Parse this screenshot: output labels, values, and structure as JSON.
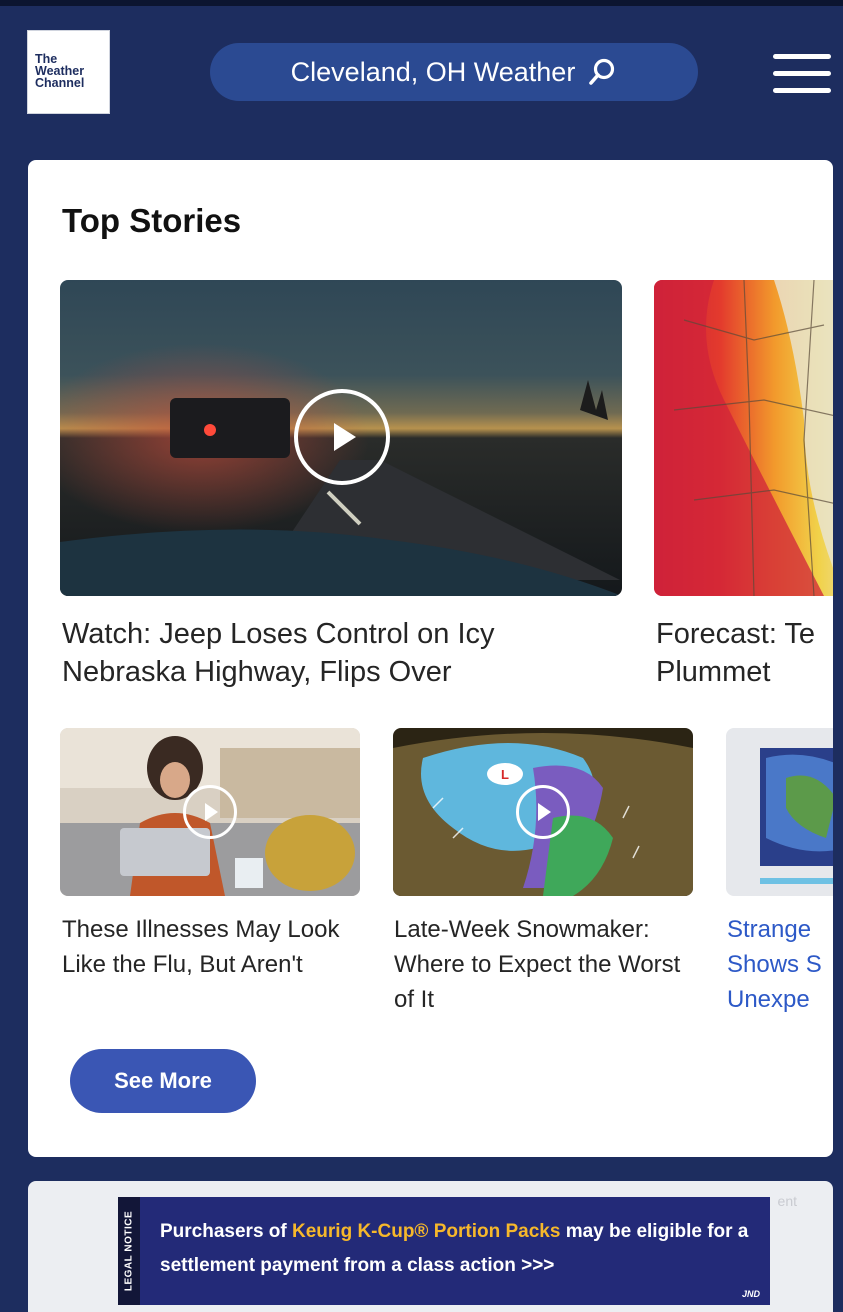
{
  "header": {
    "logo_lines": [
      "The",
      "Weather",
      "Channel"
    ],
    "search_text": "Cleveland, OH Weather"
  },
  "top_stories": {
    "title": "Top Stories",
    "featured": [
      {
        "headline": "Watch: Jeep Loses Control on Icy Nebraska Highway, Flips Over",
        "has_video": true
      },
      {
        "headline": "Forecast: Te Plummet",
        "has_video": false
      }
    ],
    "secondary": [
      {
        "headline": "These Illnesses May Look Like the Flu, But Aren't",
        "has_video": true
      },
      {
        "headline": "Late-Week Snowmaker: Where to Expect the Worst of It",
        "has_video": true
      },
      {
        "headline": "Strange Shows S Unexpe",
        "has_video": false
      }
    ],
    "see_more_label": "See More"
  },
  "ad": {
    "tag": "ent",
    "legal_label": "LEGAL NOTICE",
    "text_part1": "Purchasers of ",
    "highlight": "Keurig K-Cup® Portion Packs",
    "text_part2": " may be eligible for a settlement payment from a class action >>>",
    "brand": "JND"
  },
  "colors": {
    "header_bg": "#1d2d5f",
    "search_pill": "#2b4a92",
    "button": "#3a56b4",
    "link": "#2d59c7",
    "ad_bg": "#232a78",
    "ad_highlight": "#f6b82b"
  }
}
